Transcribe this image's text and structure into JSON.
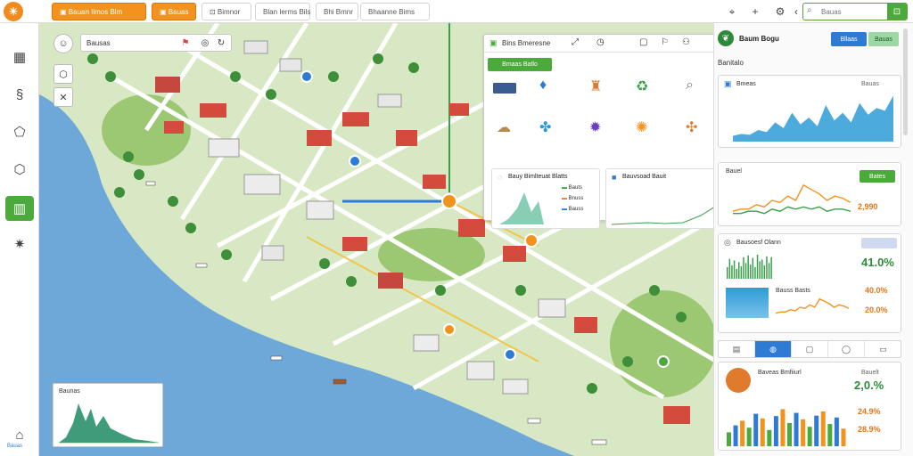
{
  "app": {
    "logo_glyph": "☀"
  },
  "topbar": {
    "tabs": [
      {
        "label": "▣ Bauan Ilmos Blm"
      },
      {
        "label": "▣ Bauas"
      },
      {
        "label": "⊡ Bimnor"
      },
      {
        "label": "Blan Ierms Bils"
      },
      {
        "label": "Bhi Bmnr"
      },
      {
        "label": "Bhaanne Bims"
      }
    ],
    "icons": [
      "crosshair-icon",
      "plus-icon",
      "settings-icon",
      "chevron-left-icon"
    ],
    "search": {
      "placeholder": "Bauas",
      "value": ""
    }
  },
  "sidebar": {
    "items": [
      {
        "icon": "grid-icon",
        "glyph": "▦"
      },
      {
        "icon": "route-icon",
        "glyph": "§"
      },
      {
        "icon": "map-pin-icon",
        "glyph": "⬠"
      },
      {
        "icon": "location-icon",
        "glyph": "⬡"
      },
      {
        "icon": "layers-icon",
        "glyph": "▥"
      },
      {
        "icon": "star-icon",
        "glyph": "✷"
      },
      {
        "icon": "home-icon",
        "glyph": "⌂"
      }
    ],
    "footer_label": "Bauas"
  },
  "map": {
    "toolbar_label": "Bausas",
    "legend": {
      "title": "Bins Bmeresne",
      "green_label": "Bmaas Batlo",
      "chart1_title": "Bauy Bimlteuat Blatts",
      "chart2_title": "Bauvsoad Bauit",
      "chart1_legend": [
        "Bauts",
        "Bnuss",
        "Bauss"
      ]
    },
    "mini_hist_title": "Baunas",
    "colors": {
      "water": "#6ea8d8",
      "land": "#cfe3b4",
      "road": "#ffffff",
      "park": "#7db55a"
    }
  },
  "rpanel": {
    "title": "Baum Bogu",
    "btn_primary": "Bllaas",
    "btn_secondary": "Bauas",
    "subtitle": "Banitalo",
    "card1": {
      "title": "Bmeas",
      "meta": "Bauas"
    },
    "card2": {
      "title": "Bauel",
      "badge": "Bates",
      "pct": "2,990"
    },
    "card3": {
      "title": "Bausoesf Olann",
      "pct_big": "41.0%",
      "pct_label": "40.0%",
      "sub": "Bauss Basts",
      "pct2": "20.0%"
    },
    "card4": {
      "title": "Baveas Bmfiiurl",
      "meta": "Bauelt",
      "value": "2,0.%",
      "value2": "24.9%",
      "value3": "28.9%"
    }
  },
  "chart_data": [
    {
      "type": "bar",
      "title": "",
      "categories": [
        "1",
        "2",
        "3",
        "4",
        "5",
        "6",
        "7",
        "8",
        "9",
        "10",
        "11",
        "12",
        "13",
        "14",
        "15",
        "16",
        "17",
        "18",
        "19",
        "20"
      ],
      "values": [
        1.4,
        2.4,
        1.6,
        2.2,
        1.2,
        2.0,
        1.5,
        2.6,
        1.9,
        2.8,
        1.7,
        2.5,
        1.4,
        2.9,
        2.1,
        2.3,
        1.6,
        2.7,
        1.9,
        2.6
      ],
      "ylim": [
        0,
        3
      ]
    },
    {
      "type": "line",
      "title": "",
      "x": [
        1,
        2,
        3,
        4,
        5,
        6,
        7,
        8,
        9,
        10,
        11,
        12,
        13,
        14,
        15,
        16,
        17,
        18,
        19,
        20
      ],
      "series": [
        {
          "values": [
            6,
            8,
            7,
            12,
            10,
            20,
            14,
            30,
            18,
            25,
            16,
            38,
            22,
            30,
            20,
            40,
            28,
            35,
            32,
            48
          ]
        }
      ],
      "ylim": [
        0,
        50
      ]
    },
    {
      "type": "line",
      "title": "",
      "x": [
        1,
        2,
        3,
        4,
        5,
        6,
        7,
        8,
        9,
        10,
        11,
        12,
        13,
        14,
        15,
        16
      ],
      "series": [
        {
          "values": [
            4,
            5,
            5,
            7,
            6,
            9,
            8,
            11,
            9,
            16,
            14,
            12,
            9,
            11,
            10,
            8
          ]
        },
        {
          "values": [
            3,
            3,
            4,
            4,
            3,
            5,
            4,
            6,
            5,
            6,
            5,
            6,
            4,
            5,
            5,
            4
          ]
        }
      ],
      "ylim": [
        0,
        18
      ]
    },
    {
      "type": "bar",
      "title": "",
      "categories": [
        "1",
        "2",
        "3",
        "4",
        "5",
        "6",
        "7",
        "8",
        "9",
        "10",
        "11",
        "12",
        "13",
        "14",
        "15",
        "16",
        "17",
        "18"
      ],
      "values": [
        30,
        45,
        55,
        40,
        70,
        60,
        35,
        65,
        80,
        50,
        72,
        58,
        42,
        66,
        75,
        48,
        62,
        38
      ],
      "colors": [
        "#4caa3c",
        "#2e7bd6",
        "#f3931e"
      ],
      "ylim": [
        0,
        100
      ]
    }
  ]
}
